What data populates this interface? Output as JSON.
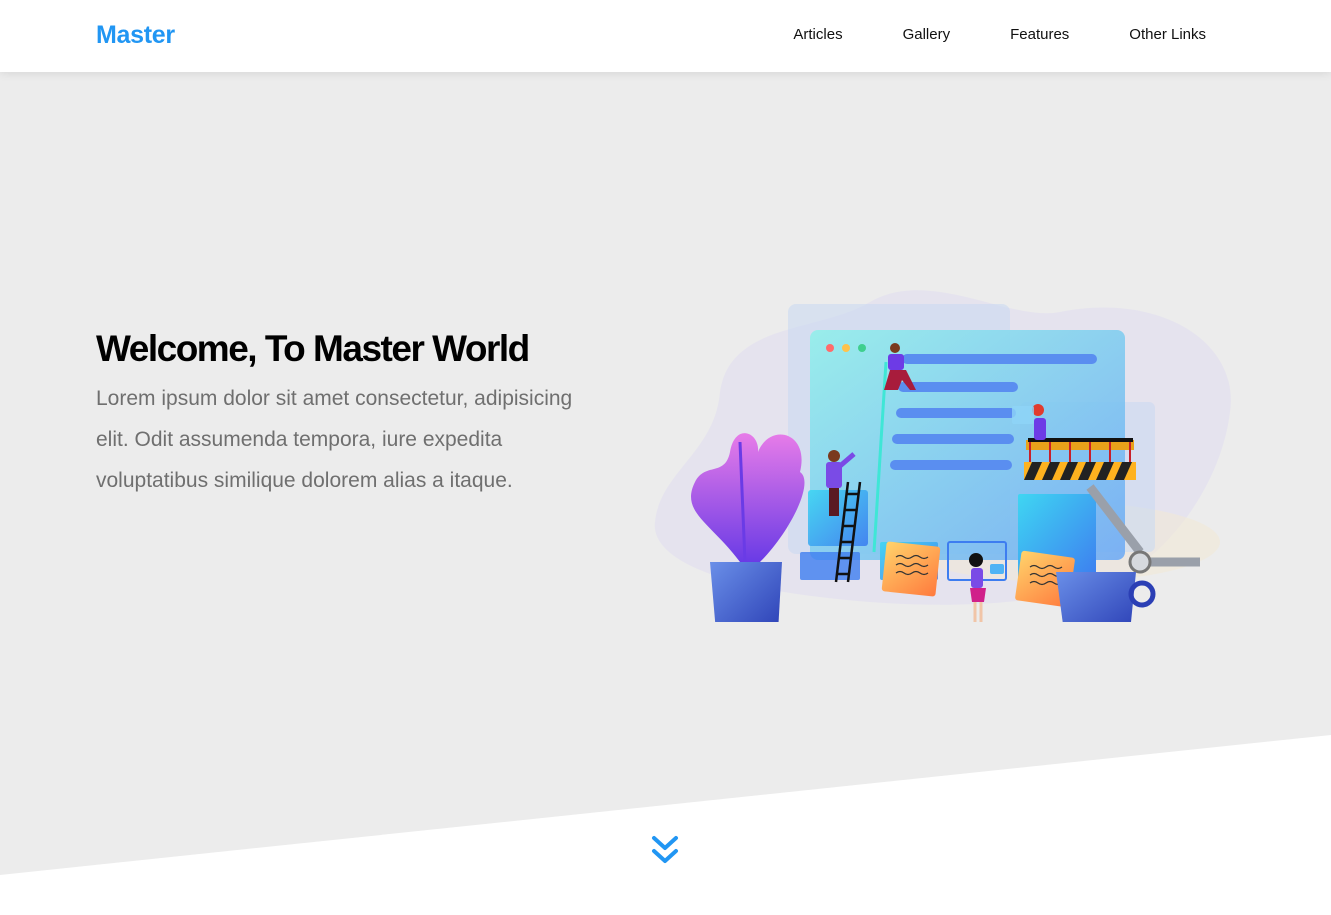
{
  "header": {
    "logo": "Master",
    "nav": [
      {
        "label": "Articles"
      },
      {
        "label": "Gallery"
      },
      {
        "label": "Features"
      },
      {
        "label": "Other Links"
      }
    ]
  },
  "hero": {
    "title": "Welcome, To Master World",
    "text": "Lorem ipsum dolor sit amet consectetur, adipisicing elit. Odit assumenda tempora, iure expedita voluptatibus similique dolorem alias a itaque."
  },
  "colors": {
    "brand": "#2196f3",
    "hero_background": "#ececec",
    "text_muted": "#6f6f6f"
  },
  "icons": {
    "scroll": "double-chevron-down-icon"
  }
}
